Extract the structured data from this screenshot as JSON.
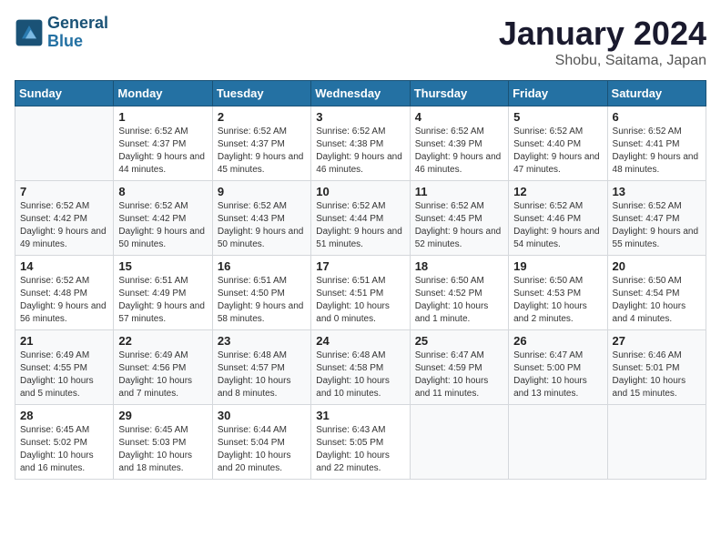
{
  "logo": {
    "line1": "General",
    "line2": "Blue"
  },
  "title": "January 2024",
  "location": "Shobu, Saitama, Japan",
  "weekdays": [
    "Sunday",
    "Monday",
    "Tuesday",
    "Wednesday",
    "Thursday",
    "Friday",
    "Saturday"
  ],
  "weeks": [
    [
      {
        "day": "",
        "sunrise": "",
        "sunset": "",
        "daylight": ""
      },
      {
        "day": "1",
        "sunrise": "Sunrise: 6:52 AM",
        "sunset": "Sunset: 4:37 PM",
        "daylight": "Daylight: 9 hours and 44 minutes."
      },
      {
        "day": "2",
        "sunrise": "Sunrise: 6:52 AM",
        "sunset": "Sunset: 4:37 PM",
        "daylight": "Daylight: 9 hours and 45 minutes."
      },
      {
        "day": "3",
        "sunrise": "Sunrise: 6:52 AM",
        "sunset": "Sunset: 4:38 PM",
        "daylight": "Daylight: 9 hours and 46 minutes."
      },
      {
        "day": "4",
        "sunrise": "Sunrise: 6:52 AM",
        "sunset": "Sunset: 4:39 PM",
        "daylight": "Daylight: 9 hours and 46 minutes."
      },
      {
        "day": "5",
        "sunrise": "Sunrise: 6:52 AM",
        "sunset": "Sunset: 4:40 PM",
        "daylight": "Daylight: 9 hours and 47 minutes."
      },
      {
        "day": "6",
        "sunrise": "Sunrise: 6:52 AM",
        "sunset": "Sunset: 4:41 PM",
        "daylight": "Daylight: 9 hours and 48 minutes."
      }
    ],
    [
      {
        "day": "7",
        "sunrise": "Sunrise: 6:52 AM",
        "sunset": "Sunset: 4:42 PM",
        "daylight": "Daylight: 9 hours and 49 minutes."
      },
      {
        "day": "8",
        "sunrise": "Sunrise: 6:52 AM",
        "sunset": "Sunset: 4:42 PM",
        "daylight": "Daylight: 9 hours and 50 minutes."
      },
      {
        "day": "9",
        "sunrise": "Sunrise: 6:52 AM",
        "sunset": "Sunset: 4:43 PM",
        "daylight": "Daylight: 9 hours and 50 minutes."
      },
      {
        "day": "10",
        "sunrise": "Sunrise: 6:52 AM",
        "sunset": "Sunset: 4:44 PM",
        "daylight": "Daylight: 9 hours and 51 minutes."
      },
      {
        "day": "11",
        "sunrise": "Sunrise: 6:52 AM",
        "sunset": "Sunset: 4:45 PM",
        "daylight": "Daylight: 9 hours and 52 minutes."
      },
      {
        "day": "12",
        "sunrise": "Sunrise: 6:52 AM",
        "sunset": "Sunset: 4:46 PM",
        "daylight": "Daylight: 9 hours and 54 minutes."
      },
      {
        "day": "13",
        "sunrise": "Sunrise: 6:52 AM",
        "sunset": "Sunset: 4:47 PM",
        "daylight": "Daylight: 9 hours and 55 minutes."
      }
    ],
    [
      {
        "day": "14",
        "sunrise": "Sunrise: 6:52 AM",
        "sunset": "Sunset: 4:48 PM",
        "daylight": "Daylight: 9 hours and 56 minutes."
      },
      {
        "day": "15",
        "sunrise": "Sunrise: 6:51 AM",
        "sunset": "Sunset: 4:49 PM",
        "daylight": "Daylight: 9 hours and 57 minutes."
      },
      {
        "day": "16",
        "sunrise": "Sunrise: 6:51 AM",
        "sunset": "Sunset: 4:50 PM",
        "daylight": "Daylight: 9 hours and 58 minutes."
      },
      {
        "day": "17",
        "sunrise": "Sunrise: 6:51 AM",
        "sunset": "Sunset: 4:51 PM",
        "daylight": "Daylight: 10 hours and 0 minutes."
      },
      {
        "day": "18",
        "sunrise": "Sunrise: 6:50 AM",
        "sunset": "Sunset: 4:52 PM",
        "daylight": "Daylight: 10 hours and 1 minute."
      },
      {
        "day": "19",
        "sunrise": "Sunrise: 6:50 AM",
        "sunset": "Sunset: 4:53 PM",
        "daylight": "Daylight: 10 hours and 2 minutes."
      },
      {
        "day": "20",
        "sunrise": "Sunrise: 6:50 AM",
        "sunset": "Sunset: 4:54 PM",
        "daylight": "Daylight: 10 hours and 4 minutes."
      }
    ],
    [
      {
        "day": "21",
        "sunrise": "Sunrise: 6:49 AM",
        "sunset": "Sunset: 4:55 PM",
        "daylight": "Daylight: 10 hours and 5 minutes."
      },
      {
        "day": "22",
        "sunrise": "Sunrise: 6:49 AM",
        "sunset": "Sunset: 4:56 PM",
        "daylight": "Daylight: 10 hours and 7 minutes."
      },
      {
        "day": "23",
        "sunrise": "Sunrise: 6:48 AM",
        "sunset": "Sunset: 4:57 PM",
        "daylight": "Daylight: 10 hours and 8 minutes."
      },
      {
        "day": "24",
        "sunrise": "Sunrise: 6:48 AM",
        "sunset": "Sunset: 4:58 PM",
        "daylight": "Daylight: 10 hours and 10 minutes."
      },
      {
        "day": "25",
        "sunrise": "Sunrise: 6:47 AM",
        "sunset": "Sunset: 4:59 PM",
        "daylight": "Daylight: 10 hours and 11 minutes."
      },
      {
        "day": "26",
        "sunrise": "Sunrise: 6:47 AM",
        "sunset": "Sunset: 5:00 PM",
        "daylight": "Daylight: 10 hours and 13 minutes."
      },
      {
        "day": "27",
        "sunrise": "Sunrise: 6:46 AM",
        "sunset": "Sunset: 5:01 PM",
        "daylight": "Daylight: 10 hours and 15 minutes."
      }
    ],
    [
      {
        "day": "28",
        "sunrise": "Sunrise: 6:45 AM",
        "sunset": "Sunset: 5:02 PM",
        "daylight": "Daylight: 10 hours and 16 minutes."
      },
      {
        "day": "29",
        "sunrise": "Sunrise: 6:45 AM",
        "sunset": "Sunset: 5:03 PM",
        "daylight": "Daylight: 10 hours and 18 minutes."
      },
      {
        "day": "30",
        "sunrise": "Sunrise: 6:44 AM",
        "sunset": "Sunset: 5:04 PM",
        "daylight": "Daylight: 10 hours and 20 minutes."
      },
      {
        "day": "31",
        "sunrise": "Sunrise: 6:43 AM",
        "sunset": "Sunset: 5:05 PM",
        "daylight": "Daylight: 10 hours and 22 minutes."
      },
      {
        "day": "",
        "sunrise": "",
        "sunset": "",
        "daylight": ""
      },
      {
        "day": "",
        "sunrise": "",
        "sunset": "",
        "daylight": ""
      },
      {
        "day": "",
        "sunrise": "",
        "sunset": "",
        "daylight": ""
      }
    ]
  ]
}
